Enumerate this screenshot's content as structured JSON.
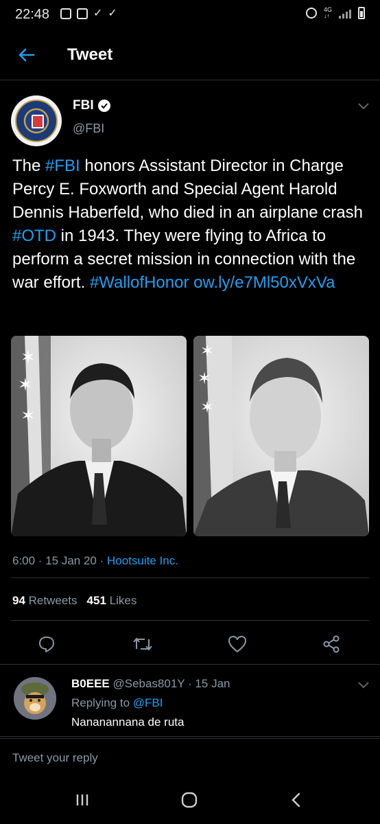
{
  "status": {
    "time": "22:48"
  },
  "header": {
    "title": "Tweet"
  },
  "tweet": {
    "display_name": "FBI",
    "handle": "@FBI",
    "text_parts": {
      "t1": "The ",
      "l1": "#FBI",
      "t2": " honors Assistant Director in Charge Percy E. Foxworth and Special Agent Harold Dennis Haberfeld, who died in an airplane crash ",
      "l2": "#OTD",
      "t3": " in 1943. They were flying to Africa to perform a secret mission in connection with the war effort. ",
      "l3": "#WallofHonor",
      "t4": " ",
      "l4": "ow.ly/e7Ml50xVxVa"
    },
    "timestamp": "6:00 · 15 Jan 20 · ",
    "source": "Hootsuite Inc.",
    "retweets_count": "94",
    "retweets_label": "Retweets",
    "likes_count": "451",
    "likes_label": "Likes"
  },
  "reply": {
    "display_name": "B0EEE",
    "handle_date": " @Sebas801Y · 15 Jan",
    "replying_prefix": "Replying to ",
    "replying_to": "@FBI",
    "text": "Nananannana de ruta"
  },
  "compose": {
    "placeholder": "Tweet your reply"
  },
  "colors": {
    "accent": "#1da1f2",
    "muted": "#8899a6",
    "background": "#000000",
    "divider": "#2f3336"
  },
  "icons": [
    "back-arrow-icon",
    "verified-badge-icon",
    "chevron-down-icon",
    "reply-icon",
    "retweet-icon",
    "like-icon",
    "share-icon",
    "recent-apps-icon",
    "home-icon",
    "nav-back-icon"
  ]
}
